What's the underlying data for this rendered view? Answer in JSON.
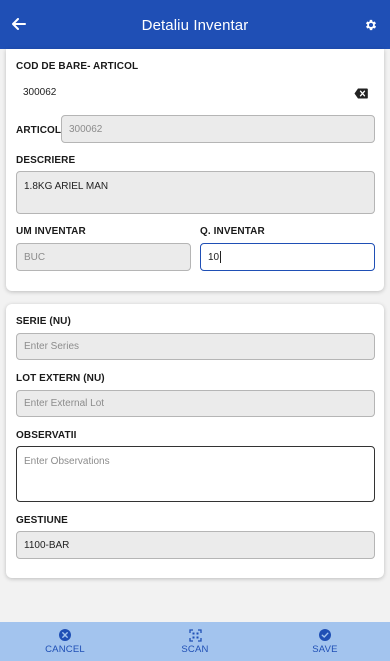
{
  "header": {
    "title": "Detaliu Inventar"
  },
  "form": {
    "barcode_label": "COD DE BARE- ARTICOL",
    "barcode_value": "300062",
    "articol_label": "ARTICOL",
    "articol_value": "300062",
    "descriere_label": "DESCRIERE",
    "descriere_value": "1.8KG ARIEL MAN",
    "um_label": "UM INVENTAR",
    "um_value": "BUC",
    "qty_label": "Q. INVENTAR",
    "qty_value": "10"
  },
  "extra": {
    "serie_label": "SERIE (NU)",
    "serie_placeholder": "Enter Series",
    "lot_label": "LOT EXTERN (NU)",
    "lot_placeholder": "Enter External Lot",
    "obs_label": "OBSERVATII",
    "obs_placeholder": "Enter Observations",
    "gestiune_label": "GESTIUNE",
    "gestiune_value": "1100-BAR"
  },
  "footer": {
    "cancel_label": "CANCEL",
    "scan_label": "SCAN",
    "save_label": "SAVE"
  },
  "colors": {
    "primary": "#1f4fb5",
    "footer_bg": "#a3c4ee",
    "page_bg": "#f2f2f2"
  },
  "icons": [
    "back-arrow-icon",
    "gear-icon",
    "backspace-icon",
    "cancel-icon",
    "scan-icon",
    "check-icon"
  ]
}
